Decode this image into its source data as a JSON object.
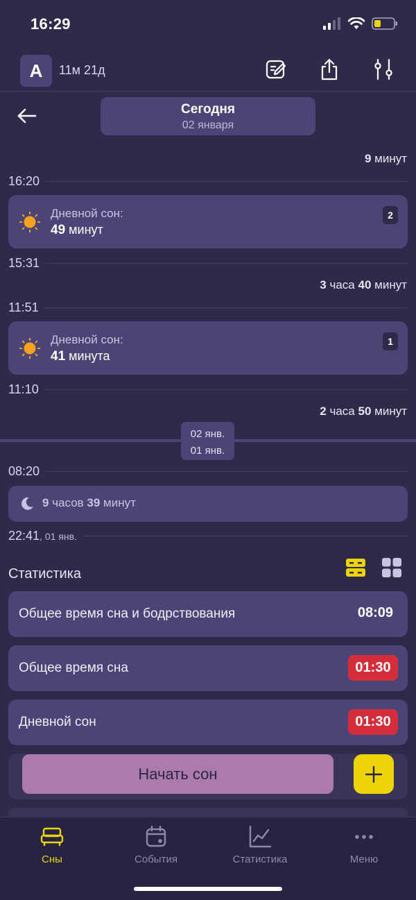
{
  "status_bar": {
    "time": "16:29"
  },
  "header": {
    "avatar_letter": "A",
    "age": "11м 21д"
  },
  "date_nav": {
    "title": "Сегодня",
    "date": "02 января"
  },
  "timeline": {
    "gap1": {
      "num": "9",
      "unit": " минут"
    },
    "t1": "16:20",
    "card1": {
      "kind": "Дневной сон:",
      "num": "49",
      "unit": " минут",
      "index": "2"
    },
    "t2": "15:31",
    "gap2": {
      "num1": "3",
      "unit1": " часа ",
      "num2": "40",
      "unit2": " минут"
    },
    "t3": "11:51",
    "card2": {
      "kind": "Дневной сон:",
      "num": "41",
      "unit": " минута",
      "index": "1"
    },
    "t4": "11:10",
    "gap3": {
      "num1": "2",
      "unit1": " часа ",
      "num2": "50",
      "unit2": " минут"
    },
    "day_chip": {
      "top": "02 янв.",
      "bottom": "01 янв."
    },
    "t5": "08:20",
    "night": {
      "num1": "9",
      "unit1": " часов ",
      "num2": "39",
      "unit2": " минут"
    },
    "t6": "22:41",
    "t6_suffix": ", 01 янв."
  },
  "stats": {
    "title": "Статистика",
    "rows": [
      {
        "label": "Общее время сна и бодрствования",
        "value": "08:09"
      },
      {
        "label": "Общее время сна",
        "value": "01:30"
      },
      {
        "label": "Дневной сон",
        "value": "01:30"
      }
    ]
  },
  "actions": {
    "start_sleep": "Начать сон",
    "add": "+"
  },
  "tabs": [
    {
      "label": "Сны",
      "icon": "bed-icon"
    },
    {
      "label": "События",
      "icon": "calendar-icon"
    },
    {
      "label": "Статистика",
      "icon": "chart-icon"
    },
    {
      "label": "Меню",
      "icon": "more-icon"
    }
  ],
  "colors": {
    "background": "#2d2a4a",
    "card": "#4b4476",
    "accent": "#ecd407",
    "alert": "#d42e3b",
    "primary_button": "#ad7aae",
    "sun": "#f6a21d"
  }
}
